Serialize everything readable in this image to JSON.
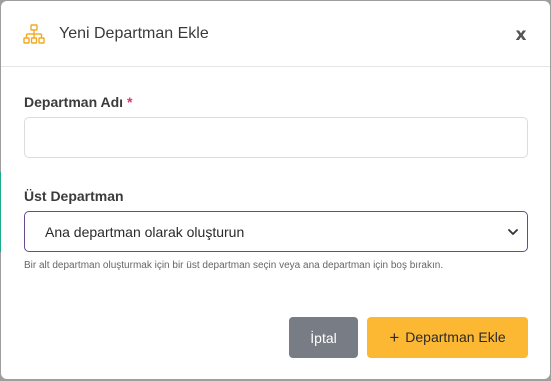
{
  "modal": {
    "title": "Yeni Departman Ekle",
    "close_label": "x",
    "header_icon": "sitemap-icon",
    "accent_color": "#fdb833"
  },
  "form": {
    "name_field": {
      "label": "Departman Adı",
      "required_marker": "*",
      "value": "",
      "placeholder": ""
    },
    "parent_field": {
      "label": "Üst Departman",
      "selected_value": "Ana departman olarak oluşturun",
      "help_text": "Bir alt departman oluşturmak için bir üst departman seçin veya ana departman için boş bırakın."
    }
  },
  "actions": {
    "cancel_label": "İptal",
    "add_label": "Departman Ekle",
    "add_icon": "plus-icon"
  }
}
